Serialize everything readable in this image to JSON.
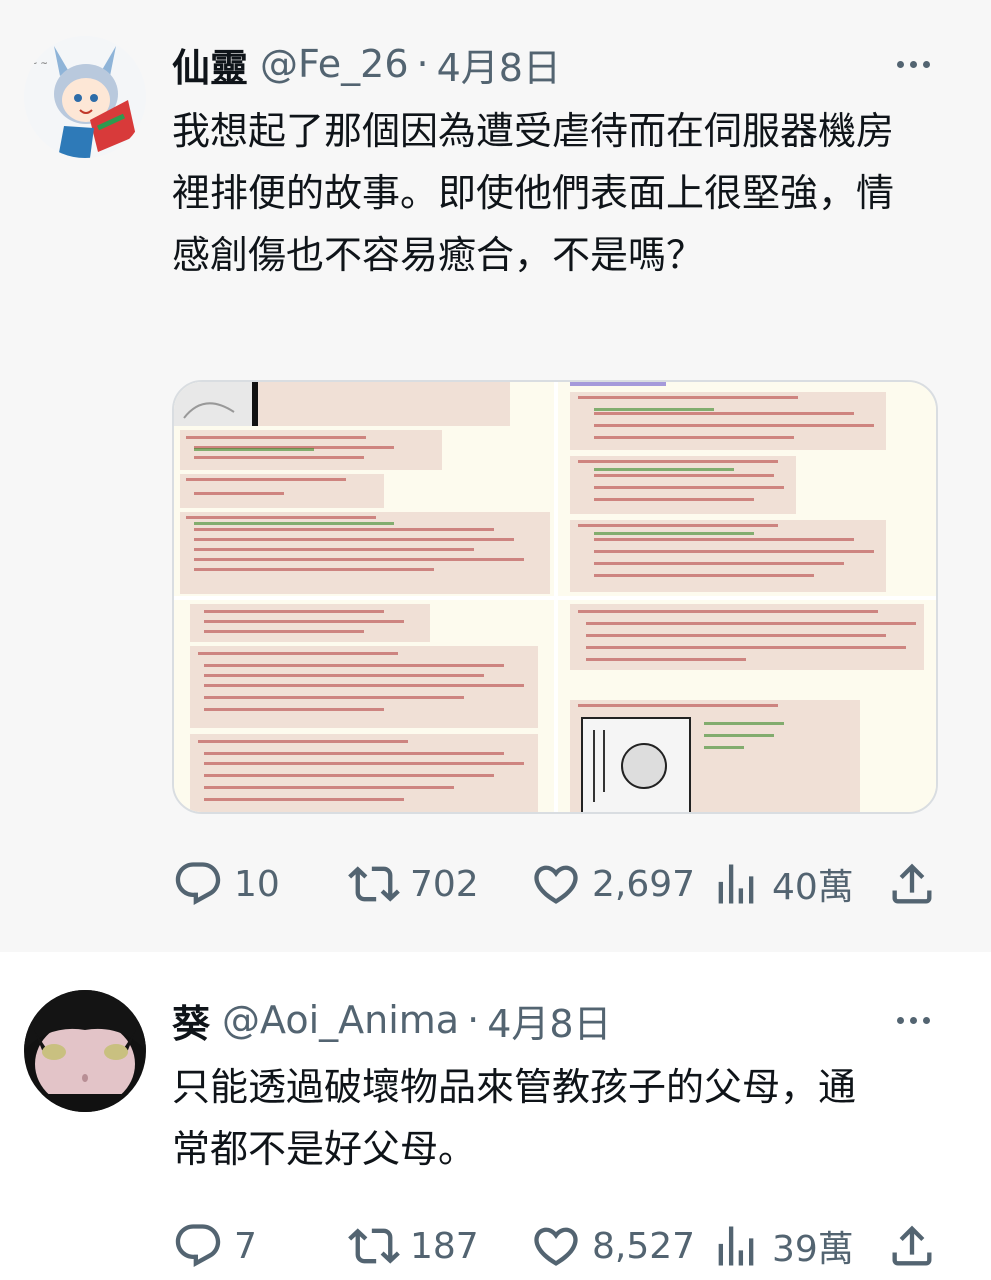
{
  "tweets": [
    {
      "name": "仙靈",
      "handle": "@Fe_26",
      "separator": "·",
      "date": "4月8日",
      "text": "我想起了那個因為遭受虐待而在伺服器機房裡排便的故事。即使他們表面上很堅強，情感創傷也不容易癒合，不是嗎？",
      "counts": {
        "replies": "10",
        "retweets": "702",
        "likes": "2,697",
        "views": "40萬"
      }
    },
    {
      "name": "葵",
      "handle": "@Aoi_Anima",
      "separator": "·",
      "date": "4月8日",
      "text": "只能透過破壞物品來管教孩子的父母，通常都不是好父母。",
      "counts": {
        "replies": "7",
        "retweets": "187",
        "likes": "8,527",
        "views": "39萬"
      }
    }
  ],
  "icons": {
    "reply": "reply-icon",
    "retweet": "retweet-icon",
    "like": "heart-icon",
    "views": "views-icon",
    "share": "share-icon",
    "more": "more-icon"
  },
  "colors": {
    "text": "#0f1419",
    "secondary": "#536471",
    "post_bg": "#fdfbee",
    "reply_bg": "#f0e0d6"
  }
}
